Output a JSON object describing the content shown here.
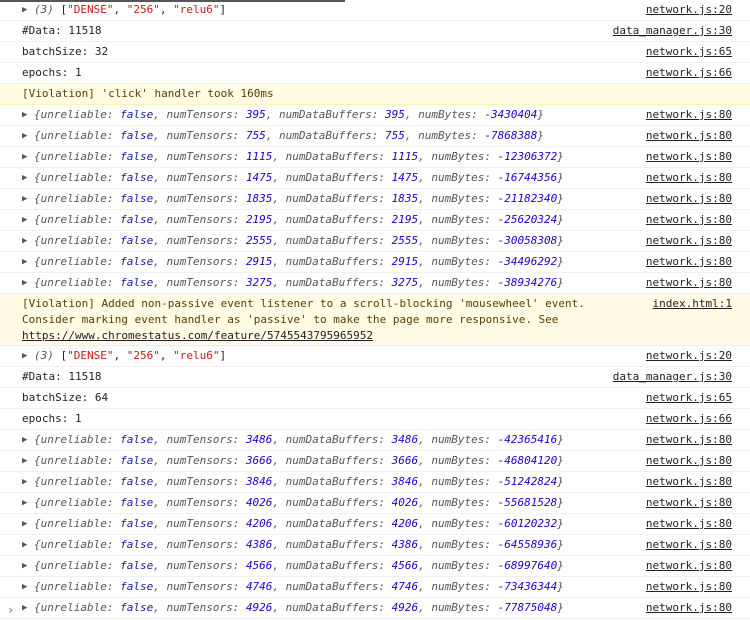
{
  "console": {
    "prompt_glyph": "›",
    "sections": [
      {
        "model_log": {
          "count": "(3)",
          "items": [
            "\"DENSE\"",
            "\"256\"",
            "\"relu6\""
          ],
          "source": "network.js:20"
        },
        "text_rows": [
          {
            "text": "#Data: 11518",
            "source": "data_manager.js:30"
          },
          {
            "text": "batchSize: 32",
            "source": "network.js:65"
          },
          {
            "text": "epochs: 1",
            "source": "network.js:66"
          }
        ],
        "violation": {
          "text": "[Violation] 'click' handler took 160ms"
        },
        "tensor_rows": [
          {
            "unreliable": "false",
            "numTensors": "395",
            "numDataBuffers": "395",
            "numBytes": "-3430404",
            "source": "network.js:80"
          },
          {
            "unreliable": "false",
            "numTensors": "755",
            "numDataBuffers": "755",
            "numBytes": "-7868388",
            "source": "network.js:80"
          },
          {
            "unreliable": "false",
            "numTensors": "1115",
            "numDataBuffers": "1115",
            "numBytes": "-12306372",
            "source": "network.js:80"
          },
          {
            "unreliable": "false",
            "numTensors": "1475",
            "numDataBuffers": "1475",
            "numBytes": "-16744356",
            "source": "network.js:80"
          },
          {
            "unreliable": "false",
            "numTensors": "1835",
            "numDataBuffers": "1835",
            "numBytes": "-21182340",
            "source": "network.js:80"
          },
          {
            "unreliable": "false",
            "numTensors": "2195",
            "numDataBuffers": "2195",
            "numBytes": "-25620324",
            "source": "network.js:80"
          },
          {
            "unreliable": "false",
            "numTensors": "2555",
            "numDataBuffers": "2555",
            "numBytes": "-30058308",
            "source": "network.js:80"
          },
          {
            "unreliable": "false",
            "numTensors": "2915",
            "numDataBuffers": "2915",
            "numBytes": "-34496292",
            "source": "network.js:80"
          },
          {
            "unreliable": "false",
            "numTensors": "3275",
            "numDataBuffers": "3275",
            "numBytes": "-38934276",
            "source": "network.js:80"
          }
        ]
      },
      {
        "model_log": {
          "count": "(3)",
          "items": [
            "\"DENSE\"",
            "\"256\"",
            "\"relu6\""
          ],
          "source": "network.js:20"
        },
        "text_rows": [
          {
            "text": "#Data: 11518",
            "source": "data_manager.js:30"
          },
          {
            "text": "batchSize: 64",
            "source": "network.js:65"
          },
          {
            "text": "epochs: 1",
            "source": "network.js:66"
          }
        ],
        "tensor_rows": [
          {
            "unreliable": "false",
            "numTensors": "3486",
            "numDataBuffers": "3486",
            "numBytes": "-42365416",
            "source": "network.js:80"
          },
          {
            "unreliable": "false",
            "numTensors": "3666",
            "numDataBuffers": "3666",
            "numBytes": "-46804120",
            "source": "network.js:80"
          },
          {
            "unreliable": "false",
            "numTensors": "3846",
            "numDataBuffers": "3846",
            "numBytes": "-51242824",
            "source": "network.js:80"
          },
          {
            "unreliable": "false",
            "numTensors": "4026",
            "numDataBuffers": "4026",
            "numBytes": "-55681528",
            "source": "network.js:80"
          },
          {
            "unreliable": "false",
            "numTensors": "4206",
            "numDataBuffers": "4206",
            "numBytes": "-60120232",
            "source": "network.js:80"
          },
          {
            "unreliable": "false",
            "numTensors": "4386",
            "numDataBuffers": "4386",
            "numBytes": "-64558936",
            "source": "network.js:80"
          },
          {
            "unreliable": "false",
            "numTensors": "4566",
            "numDataBuffers": "4566",
            "numBytes": "-68997640",
            "source": "network.js:80"
          },
          {
            "unreliable": "false",
            "numTensors": "4746",
            "numDataBuffers": "4746",
            "numBytes": "-73436344",
            "source": "network.js:80"
          },
          {
            "unreliable": "false",
            "numTensors": "4926",
            "numDataBuffers": "4926",
            "numBytes": "-77875048",
            "source": "network.js:80"
          }
        ]
      }
    ],
    "passive_violation": {
      "text": "[Violation] Added non-passive event listener to a scroll-blocking 'mousewheel' event. Consider marking event handler as 'passive' to make the page more responsive. See ",
      "link": "https://www.chromestatus.com/feature/5745543795965952",
      "source": "index.html:1"
    }
  }
}
